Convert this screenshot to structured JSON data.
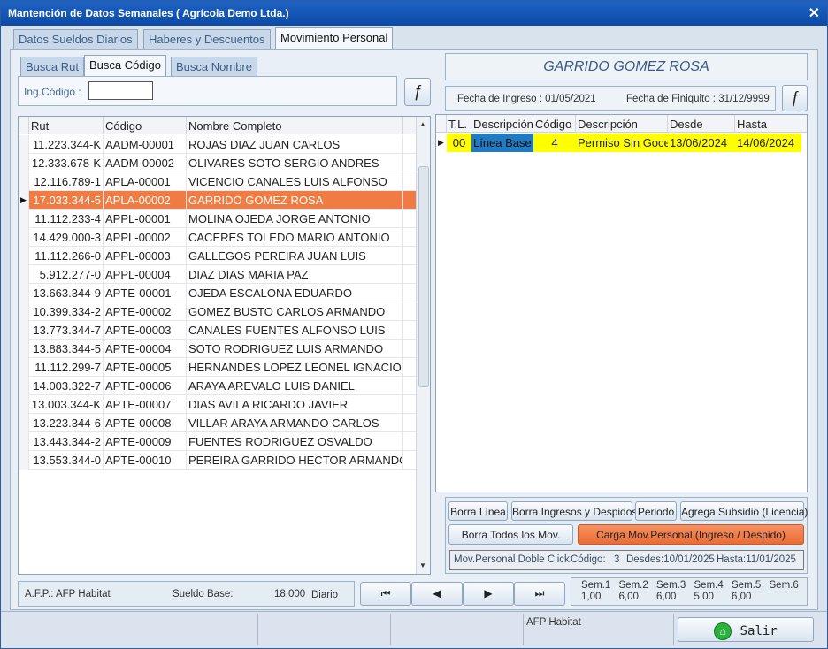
{
  "window": {
    "title": "Mantención de Datos Semanales ( Agrícola Demo Ltda.)",
    "close": "✕"
  },
  "main_tabs": [
    "Datos Sueldos Diarios",
    "Haberes y Descuentos",
    "Movimiento Personal"
  ],
  "search_tabs": [
    "Busca Rut",
    "Busca Código",
    "Busca Nombre"
  ],
  "search": {
    "label": "Ing.Código :",
    "value": ""
  },
  "func_button": "ƒ",
  "employee_grid": {
    "headers": [
      "Rut",
      "Código",
      "Nombre Completo"
    ],
    "rows": [
      {
        "rut": "11.223.344-K",
        "codigo": "AADM-00001",
        "nombre": "ROJAS DIAZ JUAN CARLOS"
      },
      {
        "rut": "12.333.678-K",
        "codigo": "AADM-00002",
        "nombre": "OLIVARES SOTO SERGIO ANDRES"
      },
      {
        "rut": "12.116.789-1",
        "codigo": "APLA-00001",
        "nombre": "VICENCIO CANALES LUIS ALFONSO"
      },
      {
        "rut": "17.033.344-5",
        "codigo": "APLA-00002",
        "nombre": "GARRIDO GOMEZ ROSA"
      },
      {
        "rut": "11.112.233-4",
        "codigo": "APPL-00001",
        "nombre": "MOLINA OJEDA JORGE ANTONIO"
      },
      {
        "rut": "14.429.000-3",
        "codigo": "APPL-00002",
        "nombre": "CACERES TOLEDO MARIO ANTONIO"
      },
      {
        "rut": "11.112.266-0",
        "codigo": "APPL-00003",
        "nombre": "GALLEGOS PEREIRA JUAN LUIS"
      },
      {
        "rut": "5.912.277-0",
        "codigo": "APPL-00004",
        "nombre": "DIAZ DIAS MARIA PAZ"
      },
      {
        "rut": "13.663.344-9",
        "codigo": "APTE-00001",
        "nombre": "OJEDA ESCALONA EDUARDO"
      },
      {
        "rut": "10.399.334-2",
        "codigo": "APTE-00002",
        "nombre": "GOMEZ BUSTO CARLOS ARMANDO"
      },
      {
        "rut": "13.773.344-7",
        "codigo": "APTE-00003",
        "nombre": "CANALES FUENTES ALFONSO LUIS"
      },
      {
        "rut": "13.883.344-5",
        "codigo": "APTE-00004",
        "nombre": "SOTO RODRIGUEZ LUIS ARMANDO"
      },
      {
        "rut": "11.112.299-7",
        "codigo": "APTE-00005",
        "nombre": "HERNANDES LOPEZ LEONEL IGNACIO"
      },
      {
        "rut": "14.003.322-7",
        "codigo": "APTE-00006",
        "nombre": "ARAYA AREVALO LUIS DANIEL"
      },
      {
        "rut": "13.003.344-K",
        "codigo": "APTE-00007",
        "nombre": "DIAS AVILA RICARDO JAVIER"
      },
      {
        "rut": "13.223.344-6",
        "codigo": "APTE-00008",
        "nombre": "VILLAR ARAYA ARMANDO CARLOS"
      },
      {
        "rut": "13.443.344-2",
        "codigo": "APTE-00009",
        "nombre": "FUENTES RODRIGUEZ OSVALDO"
      },
      {
        "rut": "13.553.344-0",
        "codigo": "APTE-00010",
        "nombre": "PEREIRA GARRIDO HECTOR ARMANDO"
      }
    ],
    "selected_index": 3
  },
  "employee": {
    "name": "GARRIDO GOMEZ ROSA",
    "ingreso": "Fecha de Ingreso : 01/05/2021",
    "finiquito": "Fecha de Finiquito : 31/12/9999"
  },
  "mov_grid": {
    "headers": [
      "T.L.",
      "Descripción",
      "Código",
      "Descripción",
      "Desde",
      "Hasta"
    ],
    "rows": [
      {
        "tl": "00",
        "desc1": "Línea Base",
        "codigo": "4",
        "desc2": "Permiso Sin Goce",
        "desde": "13/06/2024",
        "hasta": "14/06/2024"
      }
    ]
  },
  "buttons": {
    "borra_linea": "Borra Línea",
    "borra_ingresos": "Borra Ingresos y Despidos",
    "periodo": "Periodo",
    "agrega_subsidio": "Agrega Subsidio (Licencia)",
    "borra_todos": "Borra Todos los Mov.",
    "carga_mov": "Carga Mov.Personal (Ingreso / Despido)"
  },
  "doble_click": {
    "label": "Mov.Personal Doble Click:",
    "codigo_label": "Código:",
    "codigo": "3",
    "desdes": "Desdes:10/01/2025",
    "hasta": "Hasta:11/01/2025"
  },
  "footer": {
    "afp": "A.F.P.: AFP Habitat",
    "sueldo_label": "Sueldo Base:",
    "sueldo": "18.000",
    "diario": "Diario",
    "nav": [
      "⏮",
      "◀",
      "▶",
      "⏭"
    ],
    "semanas": [
      {
        "label": "Sem.1",
        "value": "1,00"
      },
      {
        "label": "Sem.2",
        "value": "6,00"
      },
      {
        "label": "Sem.3",
        "value": "6,00"
      },
      {
        "label": "Sem.4",
        "value": "5,00"
      },
      {
        "label": "Sem.5",
        "value": "6,00"
      },
      {
        "label": "Sem.6",
        "value": ""
      }
    ]
  },
  "statusbar": {
    "afp": "AFP Habitat",
    "salir": "Salir"
  },
  "colors": {
    "selected": "#f07b43",
    "yellow": "#ffff00",
    "blue_cell": "#1f7bc4",
    "carga_button": "#f07b43"
  }
}
